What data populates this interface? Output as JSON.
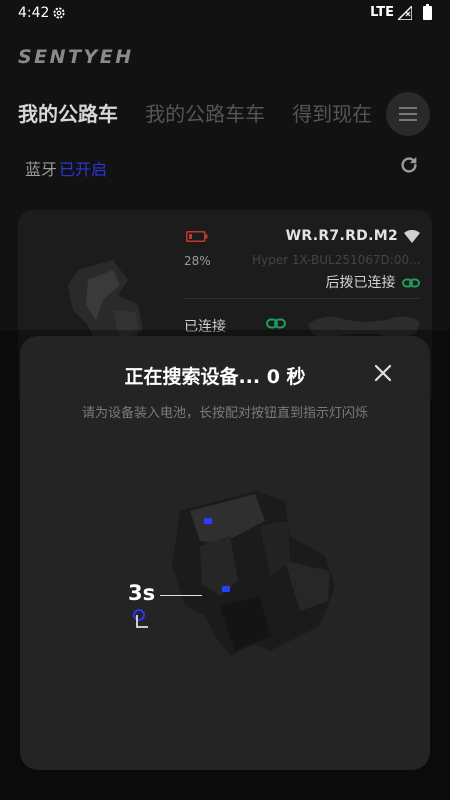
{
  "status_bar": {
    "time": "4:42",
    "network": "LTE"
  },
  "brand": "SENTYEH",
  "tabs": [
    {
      "label": "我的公路车"
    },
    {
      "label": "我的公路车车"
    },
    {
      "label": "得到现在"
    }
  ],
  "bluetooth": {
    "label": "蓝牙",
    "status": "已开启",
    "status_color": "#2b35d9"
  },
  "device_card": {
    "battery_pct": "28%",
    "battery_color": "#c0392b",
    "name": "WR.R7.RD.M2",
    "serial": "Hyper 1X-BUL251067D:00...",
    "rear_label": "后拨已连接",
    "front_status": "已连接",
    "link_color": "#1e9e5a"
  },
  "sheet": {
    "title": "正在搜索设备... 0 秒",
    "hint": "请为设备装入电池，长按配对按钮直到指示灯闪烁",
    "timer": "3s",
    "led_color": "#2a3cff"
  }
}
